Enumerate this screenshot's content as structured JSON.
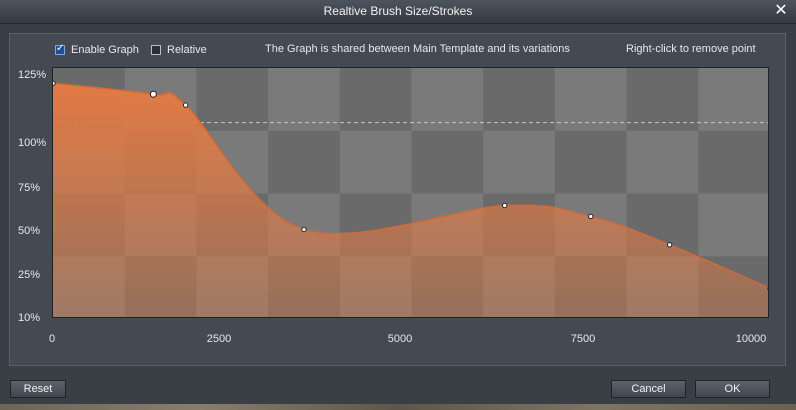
{
  "window": {
    "title": "Realtive Brush Size/Strokes"
  },
  "options": {
    "enable_graph": {
      "label": "Enable Graph",
      "checked": true
    },
    "relative": {
      "label": "Relative",
      "checked": false
    }
  },
  "info_text": "The Graph is shared between Main Template and its variations",
  "hint_text": "Right-click to remove point",
  "y_axis_labels": [
    "125%",
    "100%",
    "75%",
    "50%",
    "25%",
    "10%"
  ],
  "x_axis_labels": [
    "0",
    "2500",
    "5000",
    "7500",
    "10000"
  ],
  "chart_data": {
    "type": "area",
    "x_range": [
      0,
      10000
    ],
    "y_range_percent": [
      10,
      125
    ],
    "reference_line_percent": 100,
    "control_points": [
      {
        "x": 0,
        "y": 118
      },
      {
        "x": 1400,
        "y": 113
      },
      {
        "x": 1850,
        "y": 108
      },
      {
        "x": 3500,
        "y": 51
      },
      {
        "x": 6300,
        "y": 62
      },
      {
        "x": 7500,
        "y": 57
      },
      {
        "x": 8600,
        "y": 44
      },
      {
        "x": 10000,
        "y": 24
      }
    ],
    "fill_color": "#e27a43",
    "background_colors": [
      "#6a6a6a",
      "#7a7a7a"
    ]
  },
  "buttons": {
    "reset": "Reset",
    "cancel": "Cancel",
    "ok": "OK"
  }
}
